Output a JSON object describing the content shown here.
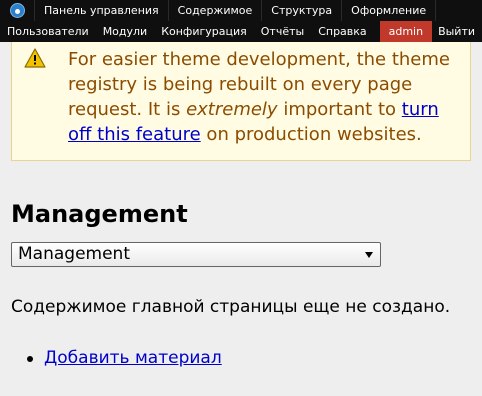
{
  "toolbar": {
    "row1": [
      "Панель управления",
      "Содержимое",
      "Структура",
      "Оформление"
    ],
    "row2": [
      "Пользователи",
      "Модули",
      "Конфигурация",
      "Отчёты",
      "Справка"
    ],
    "user_label": "admin",
    "logout_label": "Выйти",
    "home_icon": "drupal-icon",
    "user_color": "#c0392b"
  },
  "warning": {
    "icon": "warning-icon",
    "text_part1": "For easier theme development, the theme registry is being rebuilt on every page request. It is ",
    "text_emphasis": "extremely",
    "text_part2": " important to ",
    "link_text": "turn off this feature",
    "text_part3": " on production websites."
  },
  "main": {
    "title": "Management",
    "select_value": "Management",
    "empty_message": "Содержимое главной страницы еще не создано.",
    "links": [
      "Добавить материал"
    ]
  }
}
